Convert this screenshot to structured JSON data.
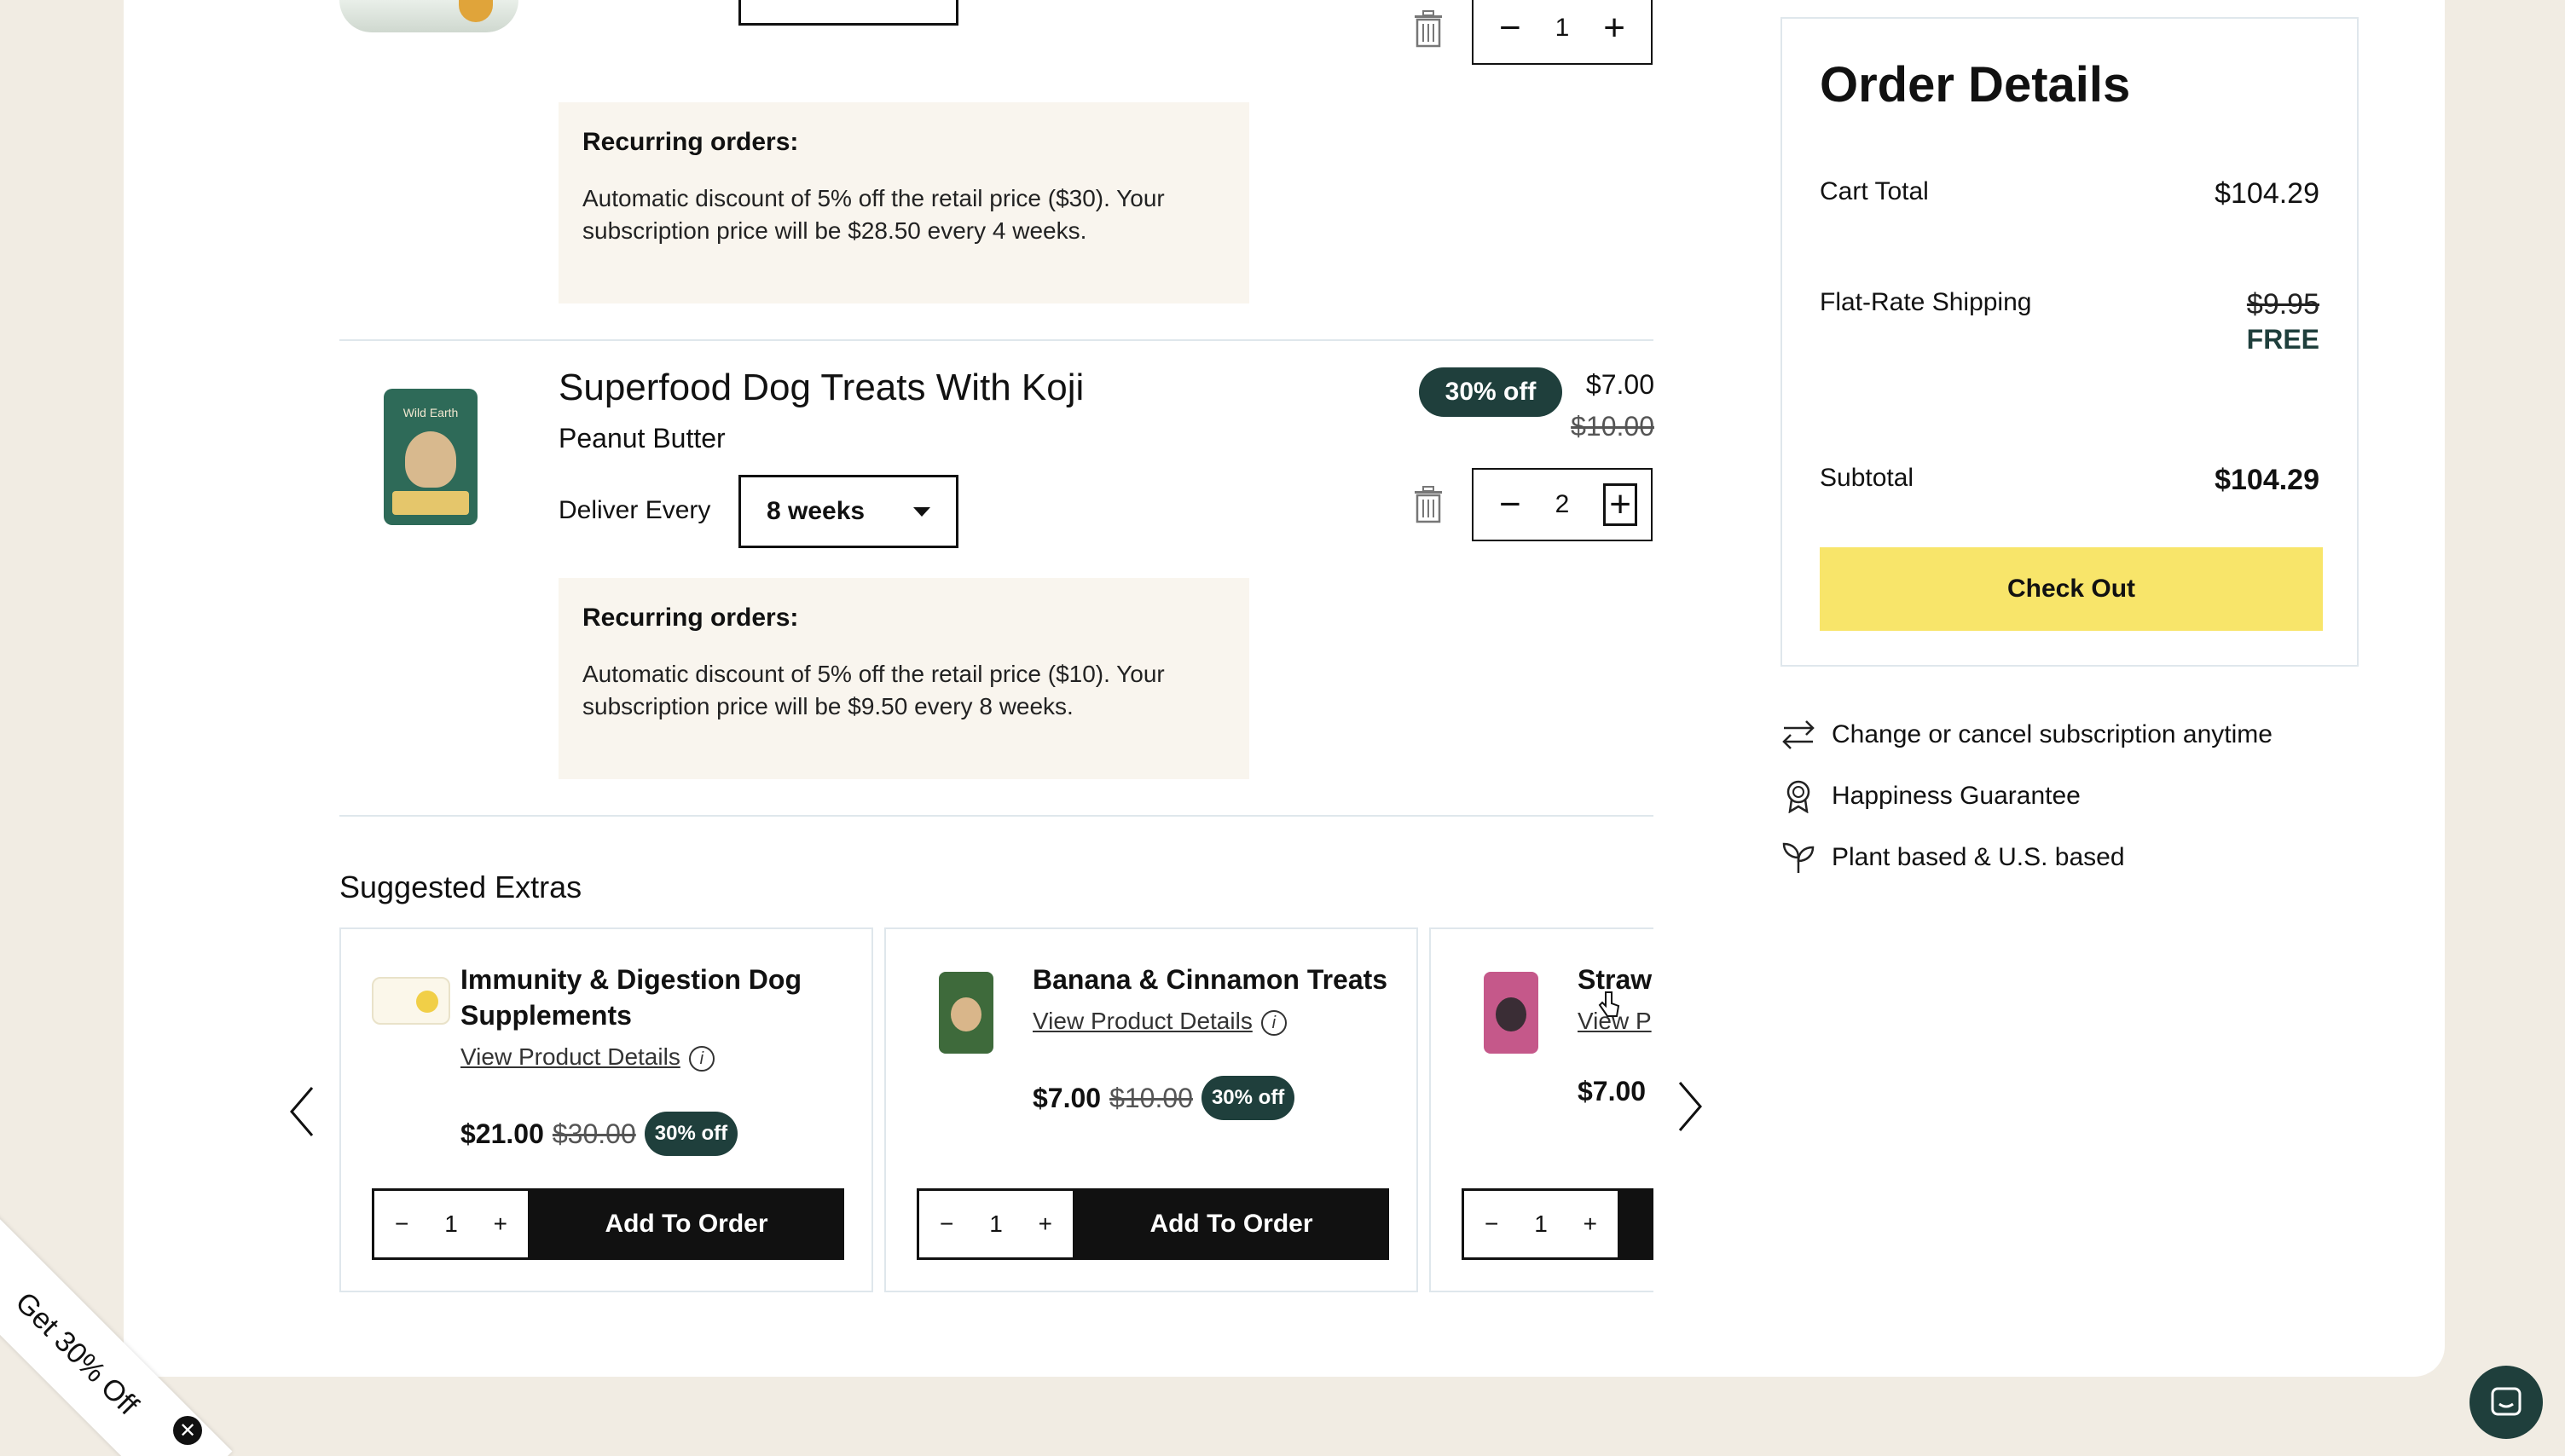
{
  "items": [
    {
      "quantity": "1",
      "recurring": {
        "heading": "Recurring orders:",
        "text": "Automatic discount of 5% off the retail price ($30). Your subscription price will be $28.50 every 4 weeks."
      }
    },
    {
      "title": "Superfood Dog Treats With Koji",
      "flavor": "Peanut Butter",
      "deliver_label": "Deliver Every",
      "deliver_value": "8 weeks",
      "badge": "30% off",
      "price": "$7.00",
      "old_price": "$10.00",
      "quantity": "2",
      "recurring": {
        "heading": "Recurring orders:",
        "text": "Automatic discount of 5% off the retail price ($10). Your subscription price will be $9.50 every 8 weeks."
      }
    }
  ],
  "extras": {
    "heading": "Suggested Extras",
    "cards": [
      {
        "name": "Immunity & Digestion Dog Supplements",
        "link": "View Product Details",
        "price": "$21.00",
        "old_price": "$30.00",
        "badge": "30% off",
        "qty": "1",
        "button": "Add To Order"
      },
      {
        "name": "Banana & Cinnamon Treats",
        "link": "View Product Details",
        "price": "$7.00",
        "old_price": "$10.00",
        "badge": "30% off",
        "qty": "1",
        "button": "Add To Order"
      },
      {
        "name": "Straw",
        "link": "View P",
        "price": "$7.00",
        "qty": "1"
      }
    ]
  },
  "order": {
    "title": "Order Details",
    "cart_total_label": "Cart Total",
    "cart_total": "$104.29",
    "shipping_label": "Flat-Rate Shipping",
    "shipping_old": "$9.95",
    "shipping_new": "FREE",
    "subtotal_label": "Subtotal",
    "subtotal": "$104.29",
    "checkout": "Check Out"
  },
  "perks": [
    {
      "icon": "swap-arrows-icon",
      "text": "Change or cancel subscription anytime"
    },
    {
      "icon": "award-ribbon-icon",
      "text": "Happiness Guarantee"
    },
    {
      "icon": "plant-leaf-icon",
      "text": "Plant based & U.S. based"
    }
  ],
  "promo": {
    "text": "Get 30% Off"
  },
  "colors": {
    "badge": "#1f3f3c",
    "checkout": "#f8e56a",
    "recurring_bg": "#f9f5ee",
    "page_bg": "#f1ece3"
  }
}
